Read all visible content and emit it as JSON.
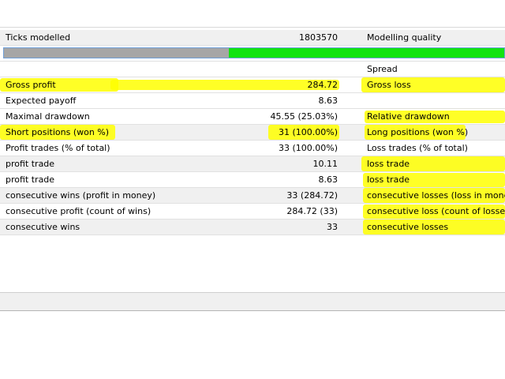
{
  "report": {
    "ticks": {
      "label": "Ticks modelled",
      "value": "1803570",
      "label2": "Modelling quality"
    },
    "quality_fraction": 0.45,
    "spread_label": "Spread",
    "rows": [
      {
        "label": "Gross profit",
        "value": "284.72",
        "label2": "Gross loss"
      },
      {
        "label": "Expected payoff",
        "value": "8.63",
        "label2": ""
      },
      {
        "label": "Maximal drawdown",
        "value": "45.55 (25.03%)",
        "label2": "Relative drawdown"
      },
      {
        "label": "Short positions (won %)",
        "value": "31 (100.00%)",
        "label2": "Long positions (won %)"
      },
      {
        "label": "Profit trades (% of total)",
        "value": "33 (100.00%)",
        "label2": "Loss trades (% of total)"
      },
      {
        "label": "profit trade",
        "value": "10.11",
        "label2": "loss trade"
      },
      {
        "label": "profit trade",
        "value": "8.63",
        "label2": "loss trade"
      },
      {
        "label": "consecutive wins (profit in money)",
        "value": "33 (284.72)",
        "label2": "consecutive losses (loss in money)"
      },
      {
        "label": "consecutive profit (count of wins)",
        "value": "284.72 (33)",
        "label2": "consecutive loss (count of losses)"
      },
      {
        "label": "consecutive wins",
        "value": "33",
        "label2": "consecutive losses"
      }
    ]
  },
  "colors": {
    "highlight": "#ffff00",
    "progress_green": "#11e311",
    "progress_gray": "#a6a6a6",
    "row_shade": "#f0f0f0"
  }
}
